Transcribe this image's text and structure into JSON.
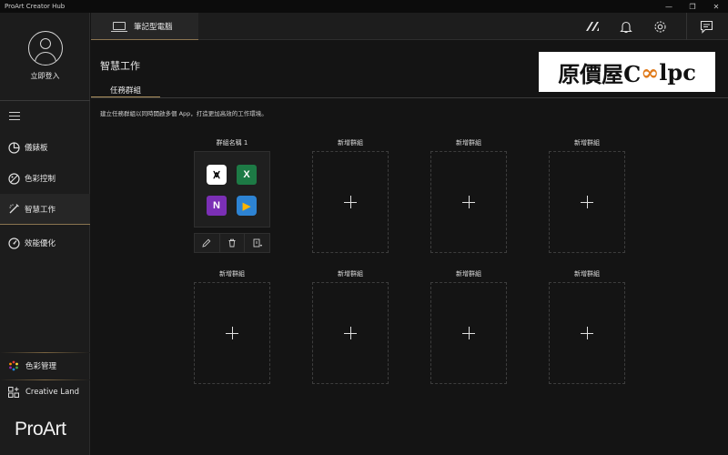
{
  "window": {
    "title": "ProArt Creator Hub",
    "controls": [
      "—",
      "❐",
      "✕"
    ]
  },
  "sidebar": {
    "login_label": "立即登入",
    "items": [
      {
        "label": "儀錶板",
        "icon": "dashboard-icon"
      },
      {
        "label": "色彩控制",
        "icon": "color-control-icon"
      },
      {
        "label": "智慧工作",
        "icon": "smart-work-icon",
        "active": true
      },
      {
        "label": "效能優化",
        "icon": "performance-icon"
      }
    ],
    "bottom": [
      {
        "label": "色彩管理",
        "icon": "color-management-icon"
      },
      {
        "label": "Creative Land",
        "icon": "creative-land-icon"
      }
    ],
    "brand": "ProArt"
  },
  "header": {
    "device_tab": "筆記型電腦",
    "icons": [
      "asus-logo-icon",
      "bell-icon",
      "gear-icon",
      "feedback-icon"
    ]
  },
  "page": {
    "title": "智慧工作",
    "logo_text_a": "原價屋C",
    "logo_text_oo": "∞",
    "logo_text_b": "lpc",
    "subtab": "任務群組",
    "description": "建立任務群組以同時開啟多個 App，打造更加高效的工作環境。",
    "groups": [
      {
        "title": "群組名稱 1",
        "apps": [
          "CapCut",
          "Excel",
          "OneNote",
          "Media Player"
        ]
      },
      {
        "title": "新增群組"
      },
      {
        "title": "新增群組"
      },
      {
        "title": "新增群組"
      },
      {
        "title": "新增群組"
      },
      {
        "title": "新增群組"
      },
      {
        "title": "新增群組"
      },
      {
        "title": "新增群組"
      }
    ],
    "app_glyphs": {
      "capcut": "⩙",
      "excel": "X",
      "onenote": "N",
      "player": "▶"
    },
    "toolbar_icons": [
      "edit-icon",
      "trash-icon",
      "export-icon"
    ]
  },
  "colors": {
    "accent_gold": "#a88c5a",
    "bg": "#141414",
    "sidebar_bg": "#1c1c1c"
  }
}
